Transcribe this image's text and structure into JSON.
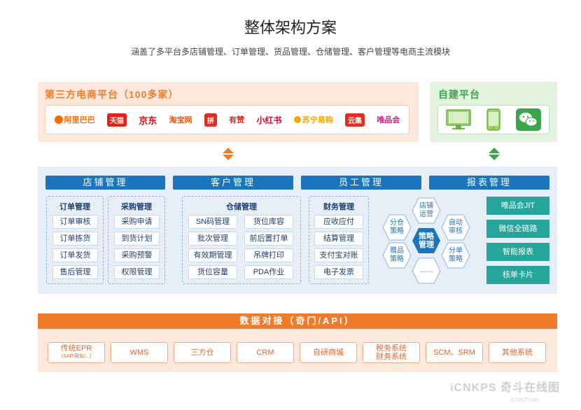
{
  "title": "整体架构方案",
  "subtitle": "涵盖了多平台多店铺管理、订单管理、货品管理、仓储管理、客户管理等电商主流模块",
  "third_party": {
    "title": "第三方电商平台（100多家）",
    "logos": [
      {
        "text": "阿里巴巴",
        "icon": "alibaba-logo",
        "color": "#ff6a00"
      },
      {
        "text": "天猫",
        "icon": "tmall-logo",
        "color": "#e2231a"
      },
      {
        "text": "京东",
        "icon": "jd-logo",
        "color": "#c8161d"
      },
      {
        "text": "淘宝网",
        "icon": "taobao-logo",
        "color": "#ff5000"
      },
      {
        "text": "拼",
        "icon": "pinduoduo-logo",
        "color": "#e02e24"
      },
      {
        "text": "有赞",
        "icon": "youzan-logo",
        "color": "#d9261c"
      },
      {
        "text": "小红书",
        "icon": "xiaohongshu-logo",
        "color": "#e4002b"
      },
      {
        "text": "苏宁易购",
        "icon": "suning-logo",
        "color": "#f7a600"
      },
      {
        "text": "云集",
        "icon": "yunji-logo",
        "color": "#e02e24"
      },
      {
        "text": "唯品会",
        "icon": "vip-logo",
        "color": "#d9188c"
      }
    ]
  },
  "self_built": {
    "title": "自建平台",
    "icons": [
      "monitor-icon",
      "mobile-icon",
      "wechat-icon"
    ]
  },
  "headers": [
    "店铺管理",
    "客户管理",
    "员工管理",
    "报表管理"
  ],
  "groups": {
    "order": {
      "title": "订单管理",
      "items": [
        "订单审核",
        "订单拣货",
        "订单发货",
        "售后管理"
      ]
    },
    "purchase": {
      "title": "采购管理",
      "items": [
        "采购申请",
        "到货计划",
        "采购预警",
        "权限管理"
      ]
    },
    "warehouse": {
      "title": "仓储管理",
      "items": [
        "SN码管理",
        "货位库容",
        "批次管理",
        "前后置打单",
        "有效期管理",
        "吊牌打印",
        "货位容量",
        "PDA作业"
      ]
    },
    "finance": {
      "title": "财务管理",
      "items": [
        "应收应付",
        "结算管理",
        "支付宝对账",
        "电子发票"
      ]
    }
  },
  "strategy": {
    "center": "策略\n管理",
    "items": [
      "店铺\n运营",
      "自动\n审核",
      "分单\n策略",
      "……",
      "赠品\n策略",
      "分仓\n策略"
    ]
  },
  "report_items": [
    "唯品会JIT",
    "微信全链路",
    "智能报表",
    "核单卡片"
  ],
  "data_bar": "数据对接（奇门/API）",
  "systems": [
    {
      "label": "传统EPR",
      "sub": "(SAP/用友/...)"
    },
    {
      "label": "WMS",
      "sub": ""
    },
    {
      "label": "三方仓",
      "sub": ""
    },
    {
      "label": "CRM",
      "sub": ""
    },
    {
      "label": "自研商城",
      "sub": ""
    },
    {
      "label": "税务系统\n财务系统",
      "sub": ""
    },
    {
      "label": "SCM、SRM",
      "sub": ""
    },
    {
      "label": "其他系统",
      "sub": ""
    }
  ],
  "watermark": "iCNKPS 奇斗在线图",
  "watermark_sub": "iCNKP.com",
  "colors": {
    "orange": "#f07b2a",
    "green": "#3aa54a",
    "blue": "#1c75bc",
    "teal": "#26a69a"
  }
}
